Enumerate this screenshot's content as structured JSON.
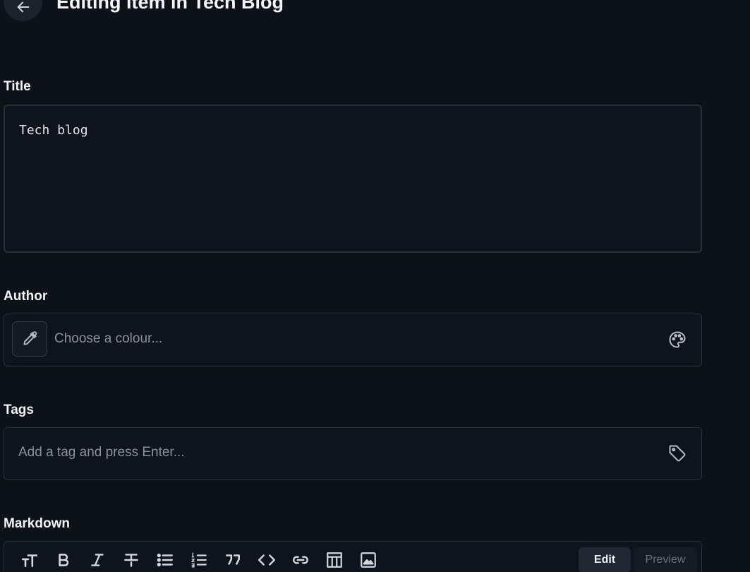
{
  "header": {
    "title": "Editing item in Tech Blog"
  },
  "fields": {
    "title": {
      "label": "Title",
      "value": "Tech blog"
    },
    "author": {
      "label": "Author",
      "placeholder": "Choose a colour..."
    },
    "tags": {
      "label": "Tags",
      "placeholder": "Add a tag and press Enter..."
    },
    "markdown": {
      "label": "Markdown",
      "tabs": {
        "edit": "Edit",
        "preview": "Preview"
      }
    }
  },
  "colors": {
    "background": "#0d1118",
    "border": "#2a303b",
    "text": "#e6e8ec",
    "placeholder": "#8a919c"
  },
  "icons": [
    "arrow-left-icon",
    "eyedropper-icon",
    "palette-icon",
    "tag-icon",
    "text-size-icon",
    "bold-icon",
    "italic-icon",
    "strikethrough-icon",
    "bullet-list-icon",
    "numbered-list-icon",
    "quote-icon",
    "code-icon",
    "link-icon",
    "table-icon",
    "image-icon"
  ]
}
